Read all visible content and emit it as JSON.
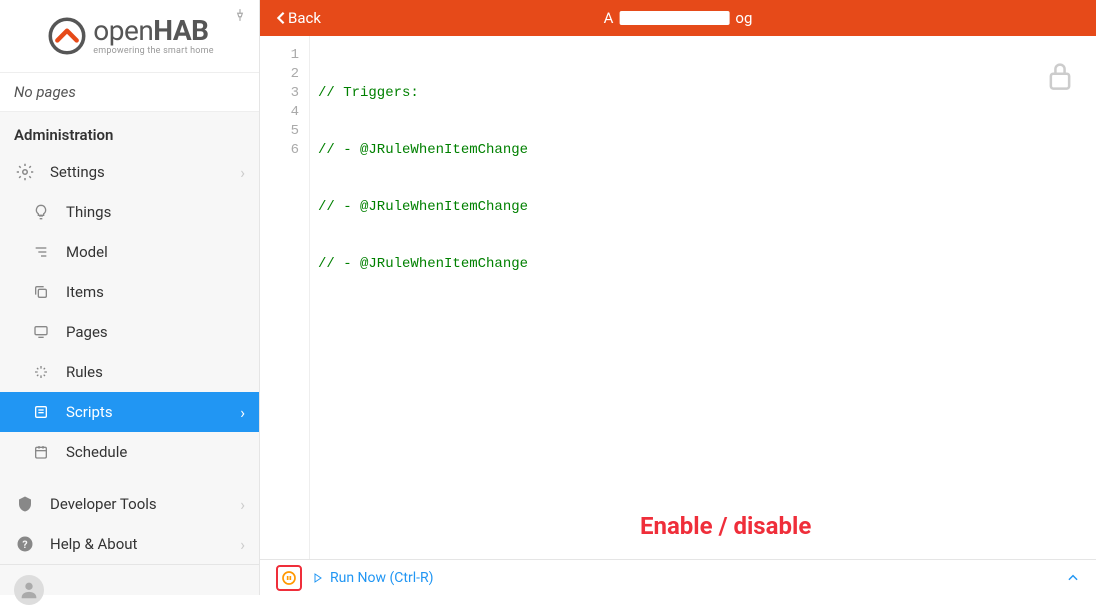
{
  "brand": {
    "name_open": "open",
    "name_hab": "HAB",
    "tagline": "empowering the smart home"
  },
  "sidebar": {
    "no_pages": "No pages",
    "admin_title": "Administration",
    "settings": "Settings",
    "items": [
      {
        "label": "Things"
      },
      {
        "label": "Model"
      },
      {
        "label": "Items"
      },
      {
        "label": "Pages"
      },
      {
        "label": "Rules"
      },
      {
        "label": "Scripts"
      },
      {
        "label": "Schedule"
      }
    ],
    "dev_tools": "Developer Tools",
    "help": "Help & About"
  },
  "header": {
    "back": "Back",
    "title_suffix": "og"
  },
  "code": {
    "lines": [
      "// Triggers:",
      "// - @JRuleWhenItemChange",
      "// - @JRuleWhenItemChange",
      "// - @JRuleWhenItemChange",
      "",
      ""
    ],
    "gutter": [
      "1",
      "2",
      "3",
      "4",
      "5",
      "6"
    ]
  },
  "annotation": "Enable / disable",
  "toolbar": {
    "run": "Run Now (Ctrl-R)"
  }
}
